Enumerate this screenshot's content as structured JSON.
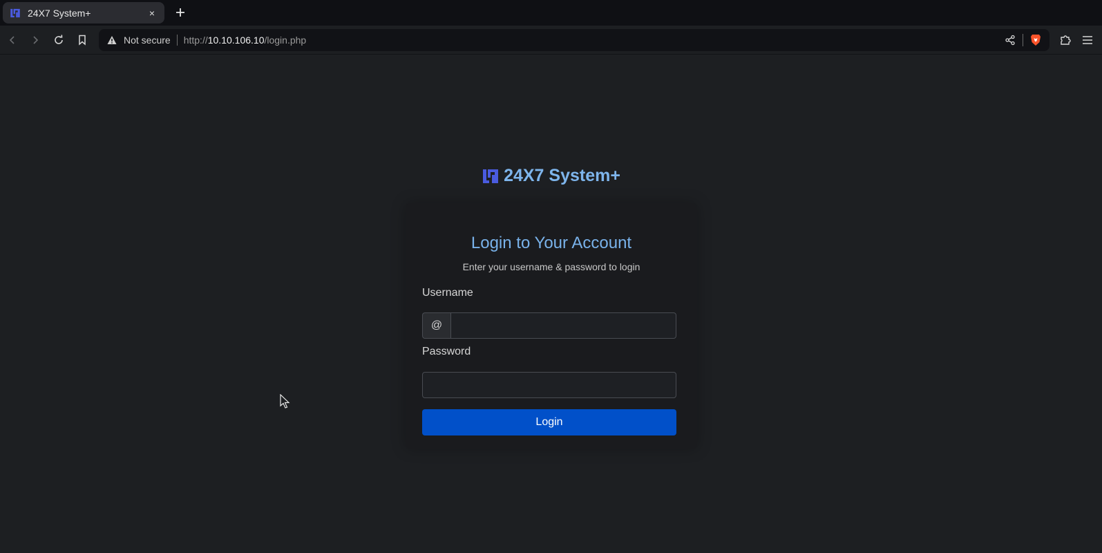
{
  "browser": {
    "tab": {
      "title": "24X7 System+",
      "close_glyph": "×"
    },
    "new_tab_icon": "plus-icon",
    "address": {
      "security_label": "Not secure",
      "url_scheme": "http://",
      "url_host": "10.10.106.10",
      "url_path": "/login.php"
    },
    "toolbar_icons": [
      "back-icon",
      "forward-icon",
      "reload-icon",
      "bookmark-icon",
      "share-icon",
      "brave-shield-icon",
      "extensions-icon",
      "menu-icon"
    ]
  },
  "page": {
    "brand_name": "24X7 System+",
    "title": "Login to Your Account",
    "subtitle": "Enter your username & password to login",
    "username_label": "Username",
    "username_addon": "@",
    "username_value": "",
    "password_label": "Password",
    "password_value": "",
    "login_label": "Login"
  },
  "colors": {
    "background": "#1d1f22",
    "accent": "#7eb5ec",
    "logo": "#4a5be0",
    "button": "#0150c9",
    "brave": "#fb542b"
  }
}
